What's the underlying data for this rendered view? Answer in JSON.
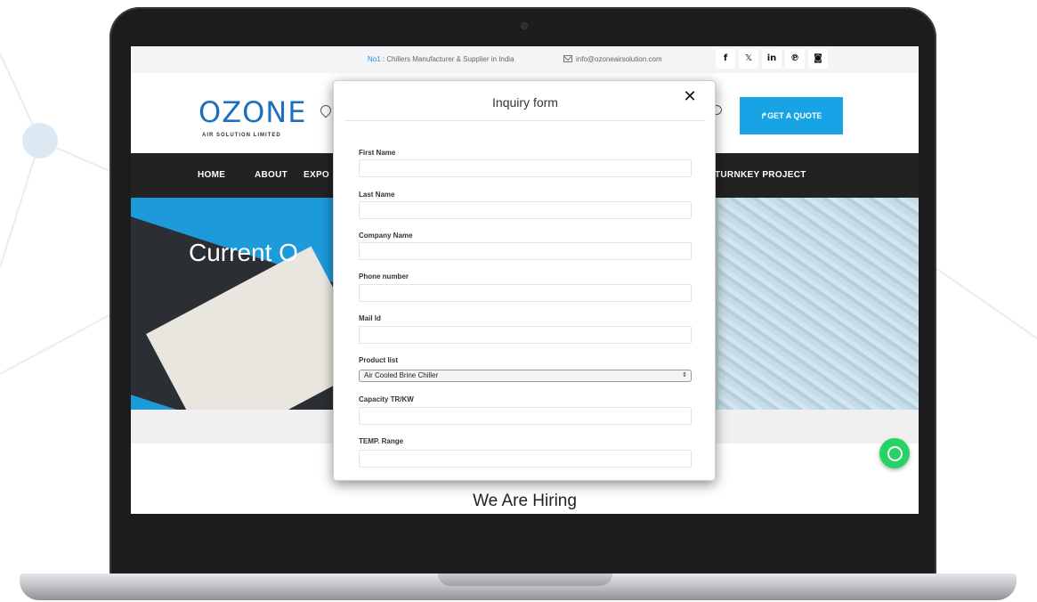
{
  "topbar": {
    "tagline_prefix": "No1",
    "tagline_rest": " : Chillers Manufacturer & Supplier in India",
    "email": "info@ozoneairsolution.com",
    "social": [
      {
        "icon": "facebook-icon",
        "glyph": "f"
      },
      {
        "icon": "x-twitter-icon",
        "glyph": "𝕏"
      },
      {
        "icon": "linkedin-icon",
        "glyph": "in"
      },
      {
        "icon": "pinterest-icon",
        "glyph": "℗"
      },
      {
        "icon": "instagram-icon",
        "glyph": "◙"
      }
    ]
  },
  "header": {
    "logo_text": "OZONE",
    "logo_sub": "AIR SOLUTION LIMITED",
    "quote_button": "↱GET A QUOTE"
  },
  "nav": {
    "items": [
      "HOME",
      "ABOUT",
      "EXPO",
      "TURNKEY PROJECT"
    ]
  },
  "hero": {
    "title": "Current O"
  },
  "section": {
    "heading": "We Are Hiring"
  },
  "modal": {
    "title": "Inquiry form",
    "close_glyph": "✕",
    "fields": [
      {
        "label": "First Name",
        "value": ""
      },
      {
        "label": "Last Name",
        "value": ""
      },
      {
        "label": "Company Name",
        "value": ""
      },
      {
        "label": "Phone number",
        "value": ""
      },
      {
        "label": "Mail Id",
        "value": ""
      }
    ],
    "product_label": "Product list",
    "product_selected": "Air Cooled Brine Chiller",
    "capacity_label": "Capacity TR/KW",
    "temp_label": "TEMP. Range"
  },
  "colors": {
    "accent": "#17a3e6",
    "nav_bg": "#222222",
    "whatsapp": "#25d366"
  }
}
